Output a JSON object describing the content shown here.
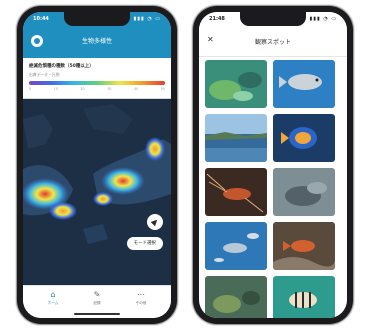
{
  "left_phone": {
    "status_time": "10:44",
    "status_icons": "▮▮▮ ◔ ▭",
    "app_title": "生物多様性",
    "legend": {
      "title": "絶滅危惧種の種数（50種以上）",
      "subtitle": "出典データ・凡例",
      "ticks": [
        "0",
        "10",
        "20",
        "30",
        "40",
        "50"
      ]
    },
    "locate_glyph": "▲",
    "mode_button": "モード選択",
    "tabs": [
      {
        "label": "ホーム",
        "icon": "⌂"
      },
      {
        "label": "記録",
        "icon": "✎"
      },
      {
        "label": "その他",
        "icon": "⋯"
      }
    ]
  },
  "right_phone": {
    "status_time": "21:48",
    "status_icons": "▮▮▮ ◔ ▭",
    "close_glyph": "✕",
    "app_title": "観察スポット",
    "photos": [
      {
        "caption": "",
        "scene": "reef-green"
      },
      {
        "caption": "",
        "scene": "fish-blue"
      },
      {
        "caption": "",
        "scene": "coast-view"
      },
      {
        "caption": "",
        "scene": "angelfish"
      },
      {
        "caption": "",
        "scene": "lobster"
      },
      {
        "caption": "",
        "scene": "seabed"
      },
      {
        "caption": "",
        "scene": "fish-school"
      },
      {
        "caption": "",
        "scene": "red-fish"
      },
      {
        "caption": "",
        "scene": "reef-algae"
      },
      {
        "caption": "",
        "scene": "striped-fish"
      }
    ]
  },
  "colors": {
    "brand": "#1f8fbf",
    "map_ocean": "#1d2f45",
    "heat_low": "#3d6fe3",
    "heat_high": "#e53a2f"
  }
}
